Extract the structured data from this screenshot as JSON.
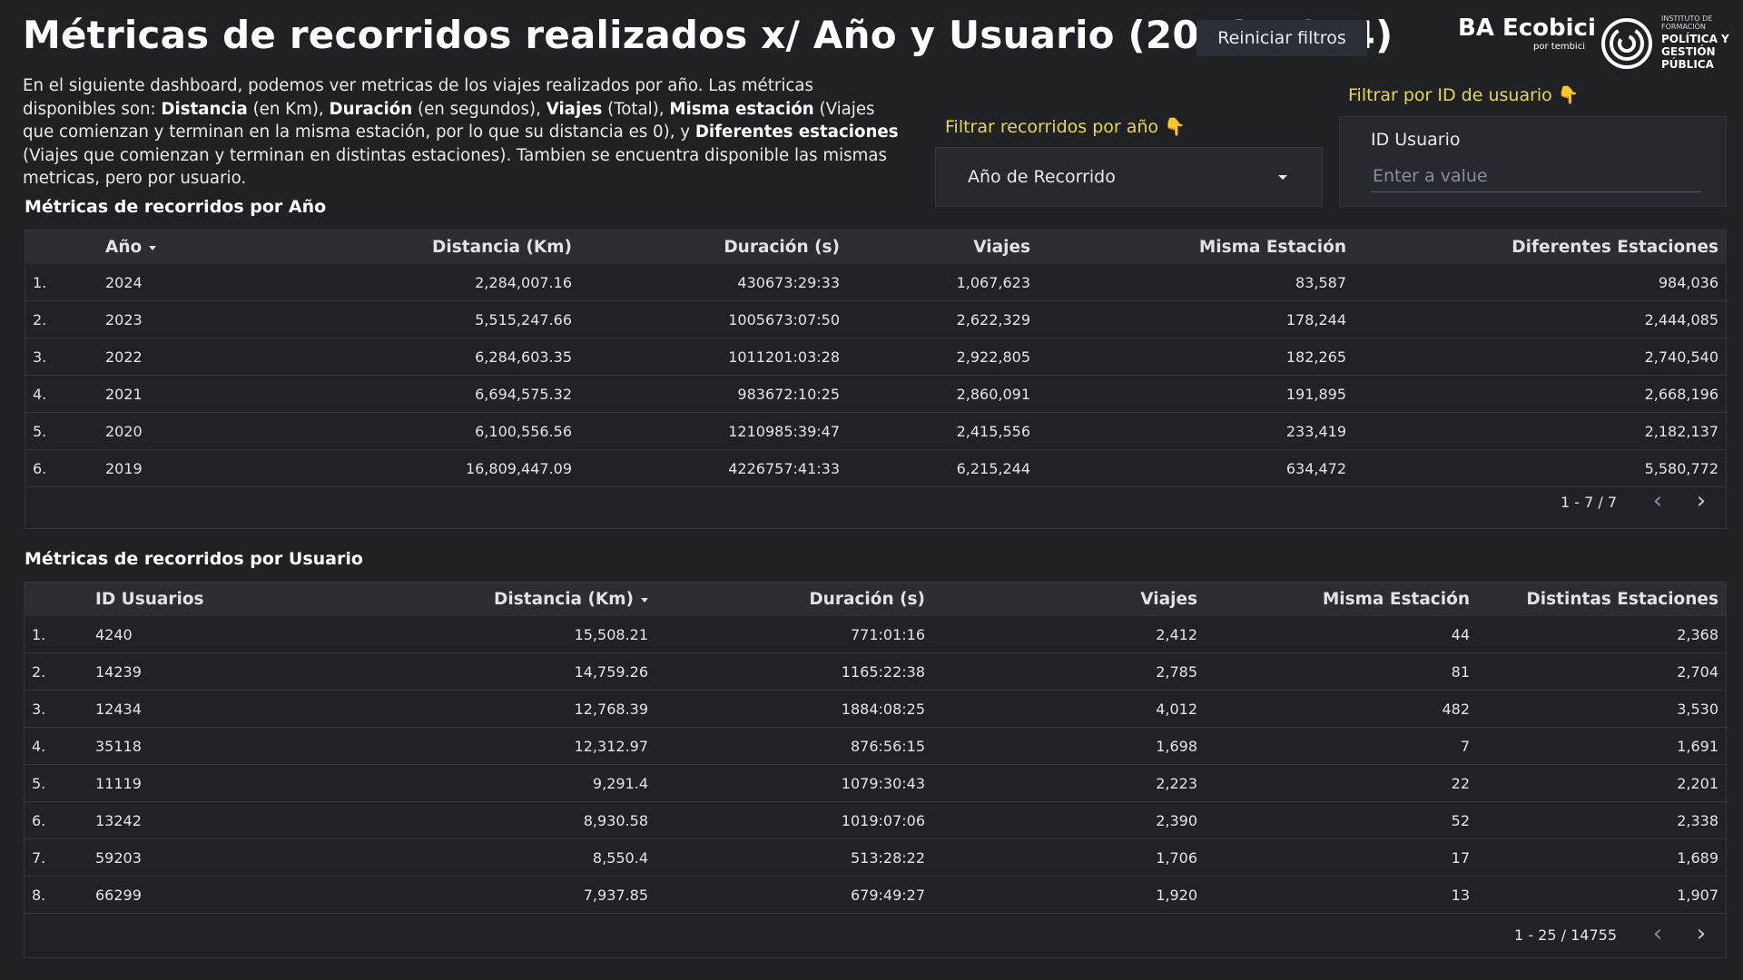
{
  "header": {
    "title": "Métricas de recorridos realizados x/ Año y Usuario (2018-2024)",
    "reset_button": "Reiniciar filtros"
  },
  "logos": {
    "ecobici_main": "BA Ecobici",
    "ecobici_sub": "por tembici",
    "institute_small": "INSTITUTO DE FORMACIÓN",
    "institute_big": "POLÍTICA Y GESTIÓN PÚBLICA"
  },
  "intro": {
    "p1": "En el siguiente dashboard, podemos ver metricas de los viajes realizados por año. Las métricas disponibles son: ",
    "b1": "Distancia",
    "p2": " (en Km), ",
    "b2": "Duración",
    "p3": " (en segundos), ",
    "b3": "Viajes",
    "p4": " (Total), ",
    "b4": "Misma estación",
    "p5": " (Viajes que comienzan y terminan en la misma estación, por lo que su distancia es 0), y ",
    "b5": "Diferentes estaciones",
    "p6": " (Viajes que comienzan y terminan en distintas estaciones). Tambien se encuentra disponible las mismas metricas, pero por usuario."
  },
  "filters": {
    "year_label": "Filtrar recorridos por año 👇",
    "year_select": "Año de Recorrido",
    "user_label": "Filtrar por ID de usuario 👇",
    "user_field_label": "ID Usuario",
    "user_placeholder": "Enter a value"
  },
  "year_table": {
    "title": "Métricas de recorridos por Año",
    "headers": [
      "Año",
      "Distancia (Km)",
      "Duración (s)",
      "Viajes",
      "Misma Estación",
      "Diferentes Estaciones"
    ],
    "rows": [
      {
        "idx": "1.",
        "year": "2024",
        "dist": "2,284,007.16",
        "dur": "430673:29:33",
        "trips": "1,067,623",
        "same": "83,587",
        "diff": "984,036"
      },
      {
        "idx": "2.",
        "year": "2023",
        "dist": "5,515,247.66",
        "dur": "1005673:07:50",
        "trips": "2,622,329",
        "same": "178,244",
        "diff": "2,444,085"
      },
      {
        "idx": "3.",
        "year": "2022",
        "dist": "6,284,603.35",
        "dur": "1011201:03:28",
        "trips": "2,922,805",
        "same": "182,265",
        "diff": "2,740,540"
      },
      {
        "idx": "4.",
        "year": "2021",
        "dist": "6,694,575.32",
        "dur": "983672:10:25",
        "trips": "2,860,091",
        "same": "191,895",
        "diff": "2,668,196"
      },
      {
        "idx": "5.",
        "year": "2020",
        "dist": "6,100,556.56",
        "dur": "1210985:39:47",
        "trips": "2,415,556",
        "same": "233,419",
        "diff": "2,182,137"
      },
      {
        "idx": "6.",
        "year": "2019",
        "dist": "16,809,447.09",
        "dur": "4226757:41:33",
        "trips": "6,215,244",
        "same": "634,472",
        "diff": "5,580,772"
      }
    ],
    "pagination": "1 - 7 / 7"
  },
  "user_table": {
    "title": "Métricas de recorridos por Usuario",
    "headers": [
      "ID Usuarios",
      "Distancia (Km)",
      "Duración (s)",
      "Viajes",
      "Misma Estación",
      "Distintas Estaciones"
    ],
    "rows": [
      {
        "idx": "1.",
        "id": "4240",
        "dist": "15,508.21",
        "dur": "771:01:16",
        "trips": "2,412",
        "same": "44",
        "diff": "2,368"
      },
      {
        "idx": "2.",
        "id": "14239",
        "dist": "14,759.26",
        "dur": "1165:22:38",
        "trips": "2,785",
        "same": "81",
        "diff": "2,704"
      },
      {
        "idx": "3.",
        "id": "12434",
        "dist": "12,768.39",
        "dur": "1884:08:25",
        "trips": "4,012",
        "same": "482",
        "diff": "3,530"
      },
      {
        "idx": "4.",
        "id": "35118",
        "dist": "12,312.97",
        "dur": "876:56:15",
        "trips": "1,698",
        "same": "7",
        "diff": "1,691"
      },
      {
        "idx": "5.",
        "id": "11119",
        "dist": "9,291.4",
        "dur": "1079:30:43",
        "trips": "2,223",
        "same": "22",
        "diff": "2,201"
      },
      {
        "idx": "6.",
        "id": "13242",
        "dist": "8,930.58",
        "dur": "1019:07:06",
        "trips": "2,390",
        "same": "52",
        "diff": "2,338"
      },
      {
        "idx": "7.",
        "id": "59203",
        "dist": "8,550.4",
        "dur": "513:28:22",
        "trips": "1,706",
        "same": "17",
        "diff": "1,689"
      },
      {
        "idx": "8.",
        "id": "66299",
        "dist": "7,937.85",
        "dur": "679:49:27",
        "trips": "1,920",
        "same": "13",
        "diff": "1,907"
      }
    ],
    "pagination": "1 - 25 / 14755"
  },
  "colors": {
    "background": "#1f2125",
    "filter_label": "#e6d84a",
    "header_row": "#2a2d31"
  }
}
